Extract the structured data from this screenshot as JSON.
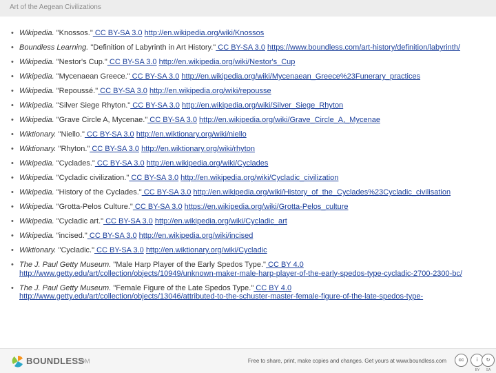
{
  "header": {
    "title": "Art of the Aegean Civilizations"
  },
  "references": [
    {
      "source": "Wikipedia.",
      "title": " \"Knossos.\"",
      "license": " CC BY-SA 3.0",
      "url": "http://en.wikipedia.org/wiki/Knossos"
    },
    {
      "source": "Boundless Learning.",
      "title": " \"Definition of Labyrinth in Art History.\"",
      "license": " CC BY-SA 3.0",
      "url": "https://www.boundless.com/art-history/definition/labyrinth/"
    },
    {
      "source": "Wikipedia.",
      "title": " \"Nestor's Cup.\"",
      "license": " CC BY-SA 3.0",
      "url": "http://en.wikipedia.org/wiki/Nestor's_Cup"
    },
    {
      "source": "Wikipedia.",
      "title": " \"Mycenaean Greece.\"",
      "license": " CC BY-SA 3.0",
      "url": "http://en.wikipedia.org/wiki/Mycenaean_Greece%23Funerary_practices"
    },
    {
      "source": "Wikipedia.",
      "title": " \"Repoussé.\"",
      "license": " CC BY-SA 3.0",
      "url": "http://en.wikipedia.org/wiki/repousse"
    },
    {
      "source": "Wikipedia.",
      "title": " \"Silver Siege Rhyton.\"",
      "license": " CC BY-SA 3.0",
      "url": "http://en.wikipedia.org/wiki/Silver_Siege_Rhyton"
    },
    {
      "source": "Wikipedia.",
      "title": " \"Grave Circle A, Mycenae.\"",
      "license": " CC BY-SA 3.0",
      "url": "http://en.wikipedia.org/wiki/Grave_Circle_A,_Mycenae"
    },
    {
      "source": "Wiktionary.",
      "title": " \"Niello.\"",
      "license": " CC BY-SA 3.0",
      "url": "http://en.wiktionary.org/wiki/niello"
    },
    {
      "source": "Wiktionary.",
      "title": " \"Rhyton.\"",
      "license": " CC BY-SA 3.0",
      "url": "http://en.wiktionary.org/wiki/rhyton"
    },
    {
      "source": "Wikipedia.",
      "title": " \"Cyclades.\"",
      "license": " CC BY-SA 3.0",
      "url": "http://en.wikipedia.org/wiki/Cyclades"
    },
    {
      "source": "Wikipedia.",
      "title": " \"Cycladic civilization.\"",
      "license": " CC BY-SA 3.0",
      "url": "http://en.wikipedia.org/wiki/Cycladic_civilization"
    },
    {
      "source": "Wikipedia.",
      "title": " \"History of the Cyclades.\"",
      "license": " CC BY-SA 3.0",
      "url": "http://en.wikipedia.org/wiki/History_of_the_Cyclades%23Cycladic_civilisation"
    },
    {
      "source": "Wikipedia.",
      "title": " \"Grotta-Pelos Culture.\"",
      "license": " CC BY-SA 3.0",
      "url": "https://en.wikipedia.org/wiki/Grotta-Pelos_culture"
    },
    {
      "source": "Wikipedia.",
      "title": " \"Cycladic art.\"",
      "license": " CC BY-SA 3.0",
      "url": "http://en.wikipedia.org/wiki/Cycladic_art"
    },
    {
      "source": "Wikipedia.",
      "title": " \"incised.\"",
      "license": " CC BY-SA 3.0",
      "url": "http://en.wikipedia.org/wiki/incised"
    },
    {
      "source": "Wiktionary.",
      "title": " \"Cycladic.\"",
      "license": " CC BY-SA 3.0",
      "url": "http://en.wiktionary.org/wiki/Cycladic"
    },
    {
      "source": "The J. Paul Getty Museum.",
      "title": " \"Male Harp Player of the Early Spedos Type.\"",
      "license": " CC BY 4.0",
      "url": "http://www.getty.edu/art/collection/objects/10949/unknown-maker-male-harp-player-of-the-early-spedos-type-cycladic-2700-2300-bc/"
    },
    {
      "source": "The J. Paul Getty Museum.",
      "title": " \"Female Figure of the Late Spedos Type.\"",
      "license": " CC BY 4.0",
      "url": "http://www.getty.edu/art/collection/objects/13046/attributed-to-the-schuster-master-female-figure-of-the-late-spedos-type-"
    }
  ],
  "footer": {
    "brand": "BOUNDLESS",
    "brand_domain": ".COM",
    "share_text": "Free to share, print, make copies and changes. Get yours at www.boundless.com",
    "cc_badges": [
      {
        "symbol": "cc",
        "caption": ""
      },
      {
        "symbol": "i",
        "caption": "BY"
      },
      {
        "symbol": "↻",
        "caption": "SA"
      }
    ]
  },
  "colors": {
    "link": "#1a3e9a",
    "header_bg": "#ededed",
    "logo_orange": "#f7941e",
    "logo_teal": "#2aa6c7",
    "logo_green": "#8cc63f"
  }
}
